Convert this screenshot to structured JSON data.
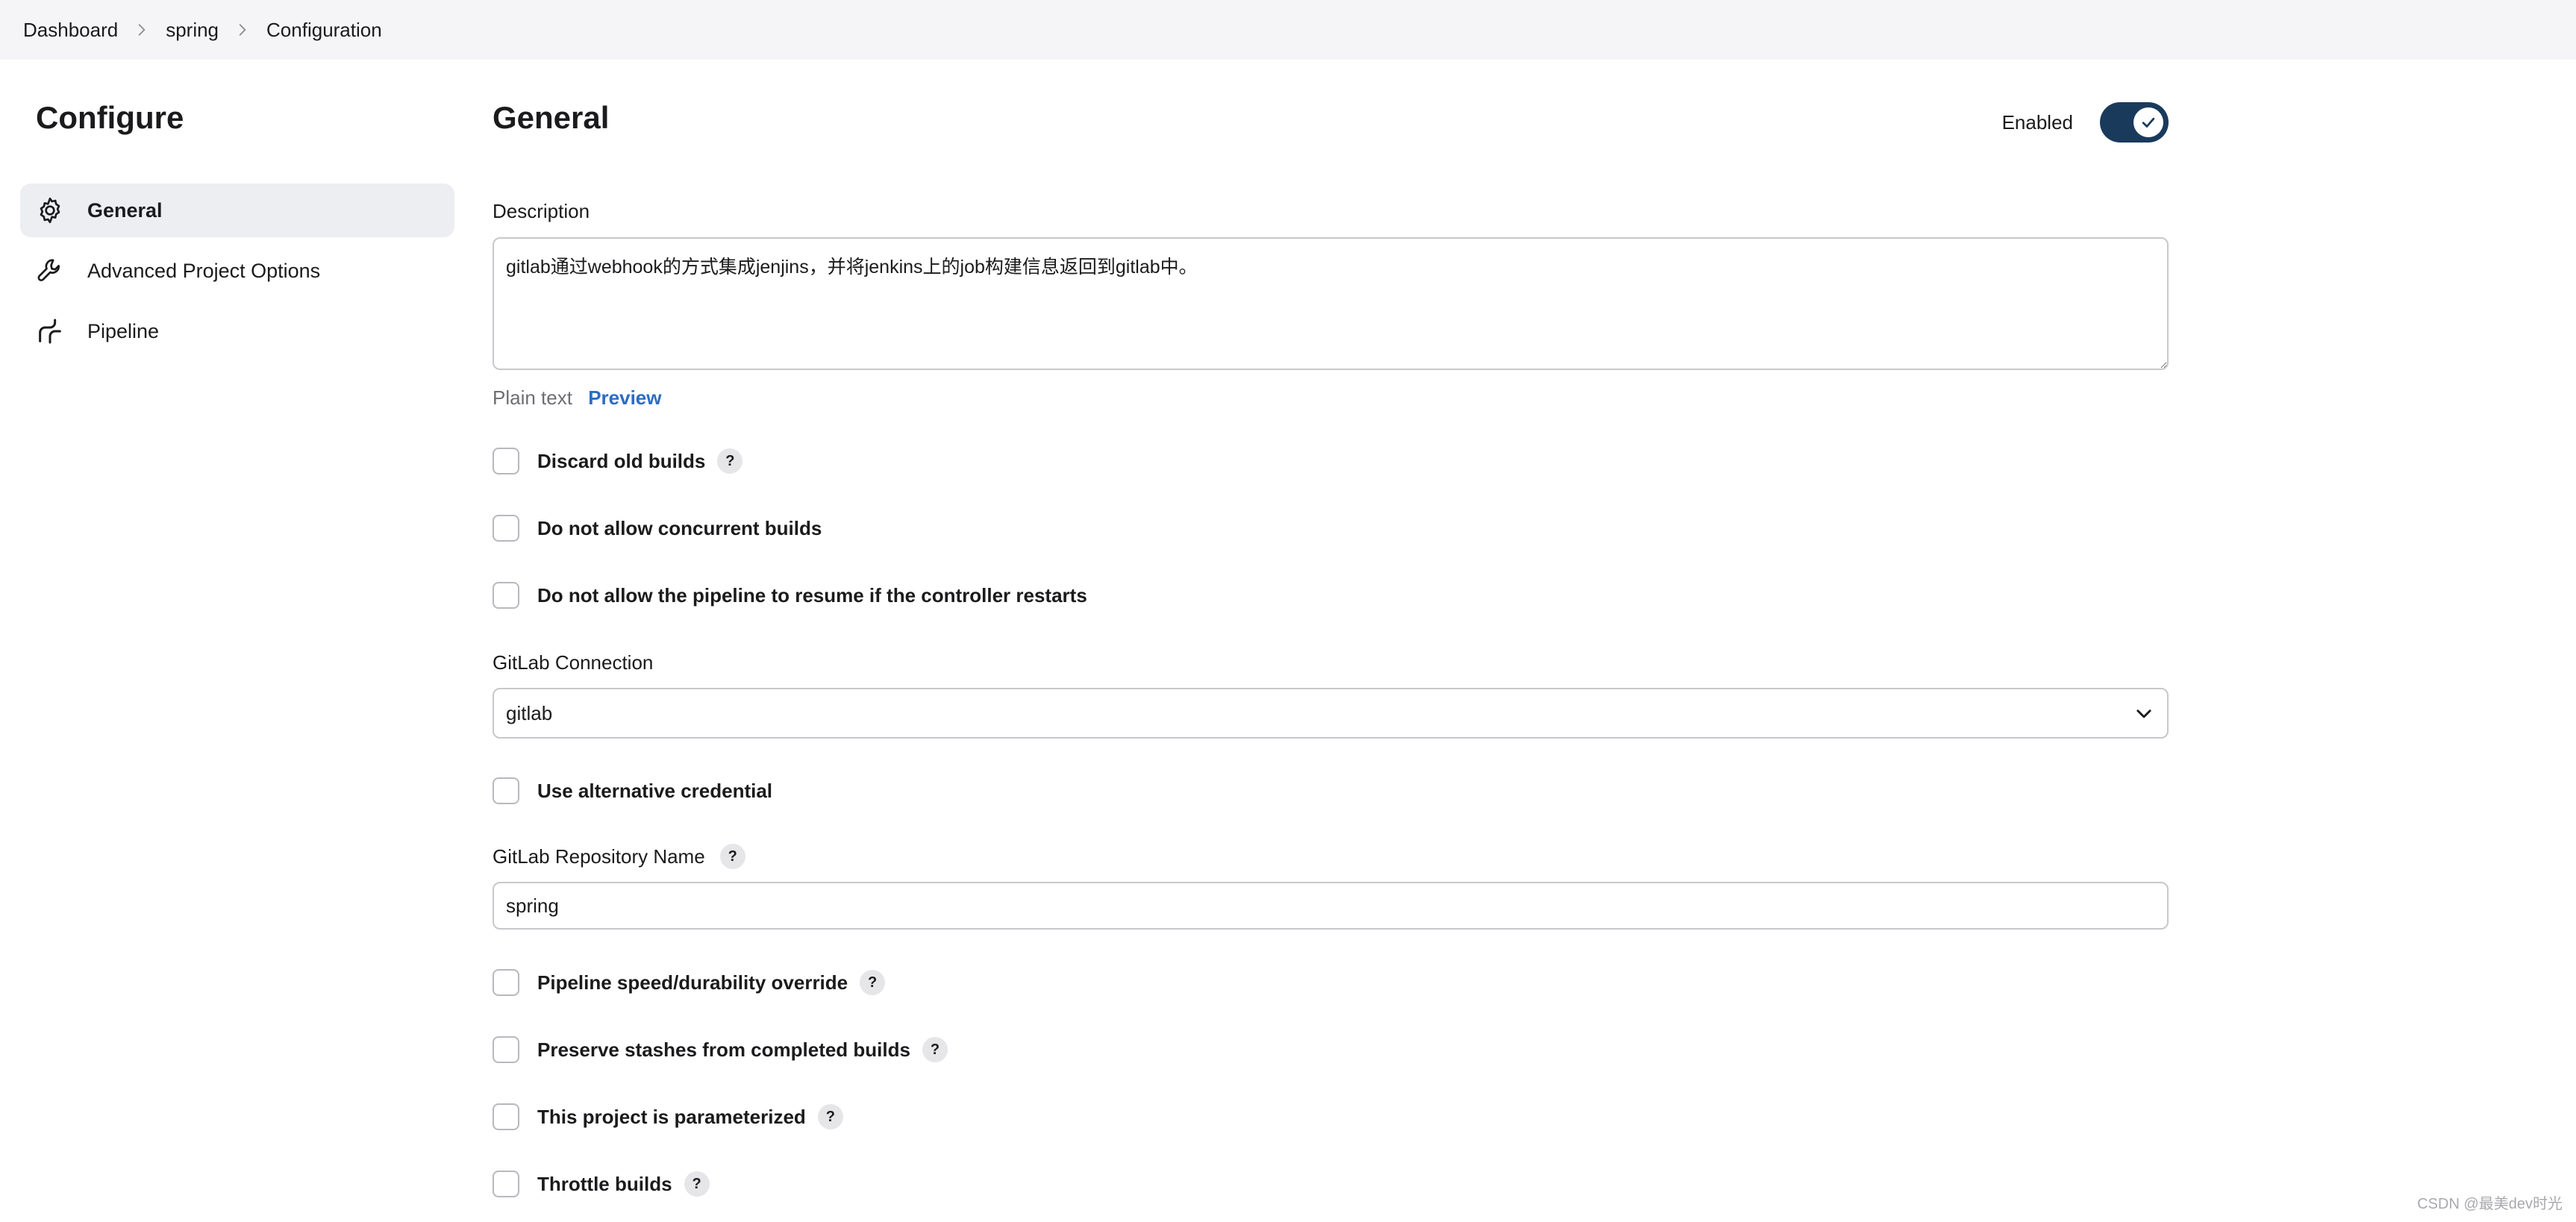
{
  "breadcrumb": {
    "items": [
      "Dashboard",
      "spring",
      "Configuration"
    ]
  },
  "sidebar": {
    "title": "Configure",
    "items": [
      {
        "label": "General",
        "icon": "gear-icon",
        "active": true
      },
      {
        "label": "Advanced Project Options",
        "icon": "wrench-icon",
        "active": false
      },
      {
        "label": "Pipeline",
        "icon": "pipeline-icon",
        "active": false
      }
    ]
  },
  "main": {
    "title": "General",
    "enabled_label": "Enabled",
    "enabled": true,
    "description": {
      "label": "Description",
      "value": "gitlab通过webhook的方式集成jenjins，并将jenkins上的job构建信息返回到gitlab中。",
      "plain_text_label": "Plain text",
      "preview_label": "Preview"
    },
    "options_top": [
      {
        "label": "Discard old builds",
        "help": "?"
      },
      {
        "label": "Do not allow concurrent builds"
      },
      {
        "label": "Do not allow the pipeline to resume if the controller restarts"
      }
    ],
    "gitlab_connection": {
      "label": "GitLab Connection",
      "selected": "gitlab"
    },
    "alt_credential": {
      "label": "Use alternative credential"
    },
    "repo_name": {
      "label": "GitLab Repository Name",
      "help": "?",
      "value": "spring"
    },
    "options_bottom": [
      {
        "label": "Pipeline speed/durability override",
        "help": "?"
      },
      {
        "label": "Preserve stashes from completed builds",
        "help": "?"
      },
      {
        "label": "This project is parameterized",
        "help": "?"
      },
      {
        "label": "Throttle builds",
        "help": "?"
      }
    ]
  },
  "watermark": "CSDN @最美dev时光",
  "colors": {
    "accent": "#2b6cc4",
    "toggle_on": "#1a3a5c",
    "active_nav_bg": "#eceef2",
    "topbar_bg": "#f5f5f7"
  }
}
